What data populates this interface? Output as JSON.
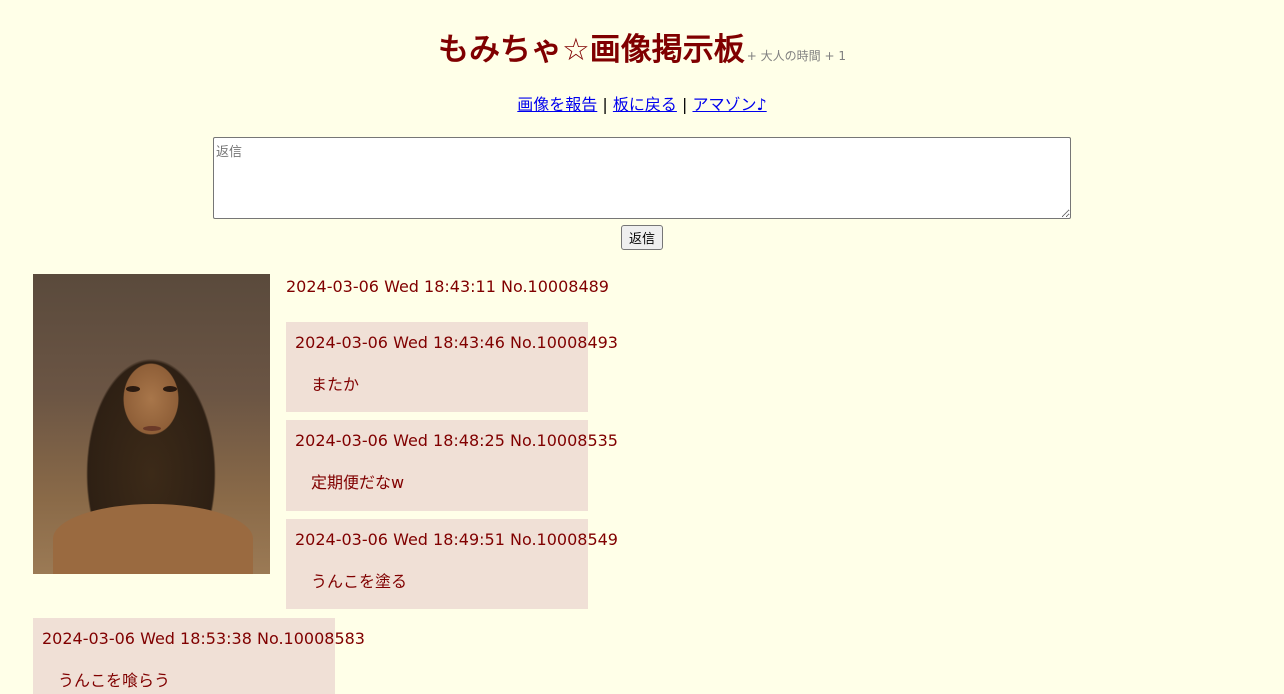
{
  "header": {
    "title": "もみちゃ☆画像掲示板",
    "subtitle": "+ 大人の時間 + 1"
  },
  "nav": {
    "links": [
      "画像を報告",
      "板に戻る",
      "アマゾン♪"
    ],
    "separator": "|"
  },
  "reply_form": {
    "placeholder": "返信",
    "button_label": "返信"
  },
  "thread": {
    "op_meta": "2024-03-06 Wed 18:43:11 No.10008489",
    "replies": [
      {
        "meta": "2024-03-06 Wed 18:43:46 No.10008493",
        "body": "またか"
      },
      {
        "meta": "2024-03-06 Wed 18:48:25 No.10008535",
        "body": "定期便だなw"
      },
      {
        "meta": "2024-03-06 Wed 18:49:51 No.10008549",
        "body": "うんこを塗る"
      },
      {
        "meta": "2024-03-06 Wed 18:53:38 No.10008583",
        "body": "うんこを喰らう"
      }
    ]
  },
  "colors": {
    "background": "#ffffe8",
    "text": "#800000",
    "post_background": "#f0e0d6",
    "link": "#0000ee"
  }
}
